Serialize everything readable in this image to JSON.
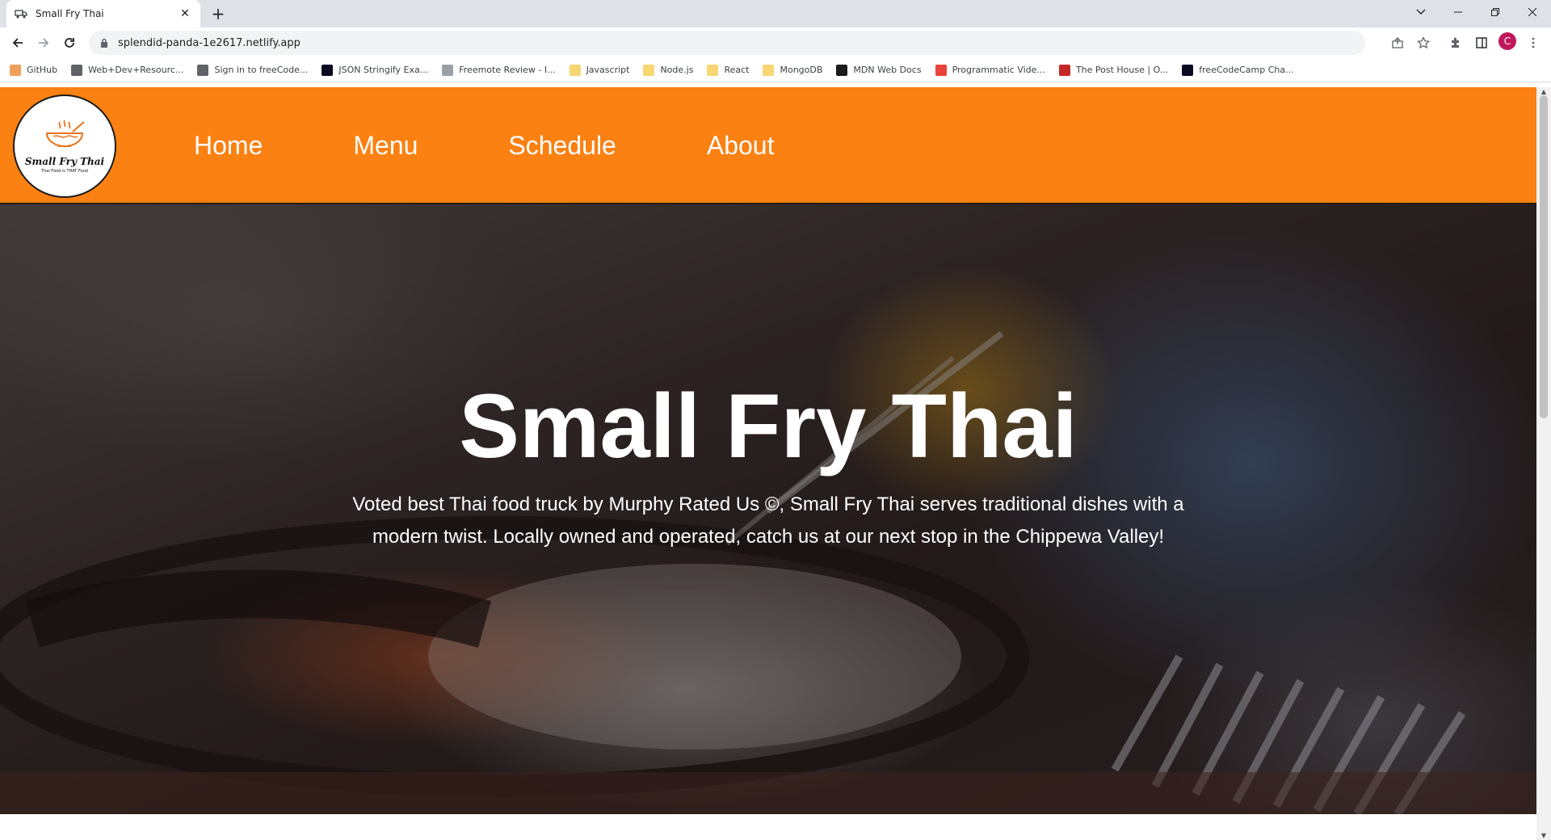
{
  "browser": {
    "tab_title": "Small Fry Thai",
    "tab_close": "✕",
    "new_tab": "+",
    "url": "splendid-panda-1e2617.netlify.app",
    "profile_initial": "C",
    "bookmarks": [
      {
        "label": "GitHub",
        "color": "#f0a05a"
      },
      {
        "label": "Web+Dev+Resourc...",
        "color": "#5f6368"
      },
      {
        "label": "Sign in to freeCode...",
        "color": "#5f6368"
      },
      {
        "label": "JSON Stringify Exa...",
        "color": "#0a0a23"
      },
      {
        "label": "Freemote Review - I...",
        "color": "#9aa0a6"
      },
      {
        "label": "Javascript",
        "color": "#f7d774"
      },
      {
        "label": "Node.js",
        "color": "#f7d774"
      },
      {
        "label": "React",
        "color": "#f7d774"
      },
      {
        "label": "MongoDB",
        "color": "#f7d774"
      },
      {
        "label": "MDN Web Docs",
        "color": "#1b1b1b"
      },
      {
        "label": "Programmatic Vide...",
        "color": "#e8453c"
      },
      {
        "label": "The Post House | O...",
        "color": "#c62828"
      },
      {
        "label": "freeCodeCamp Cha...",
        "color": "#0a0a23"
      }
    ]
  },
  "site": {
    "logo_name": "Small Fry Thai",
    "logo_tagline": "Thai Food is THAT Food",
    "nav": [
      "Home",
      "Menu",
      "Schedule",
      "About"
    ],
    "hero_title": "Small Fry Thai",
    "hero_text": "Voted best Thai food truck by Murphy Rated Us ©, Small Fry Thai serves traditional dishes with a modern twist. Locally owned and operated, catch us at our next stop in the Chippewa Valley!"
  },
  "colors": {
    "header_orange": "#fa8112",
    "logo_accent": "#e8741a"
  }
}
